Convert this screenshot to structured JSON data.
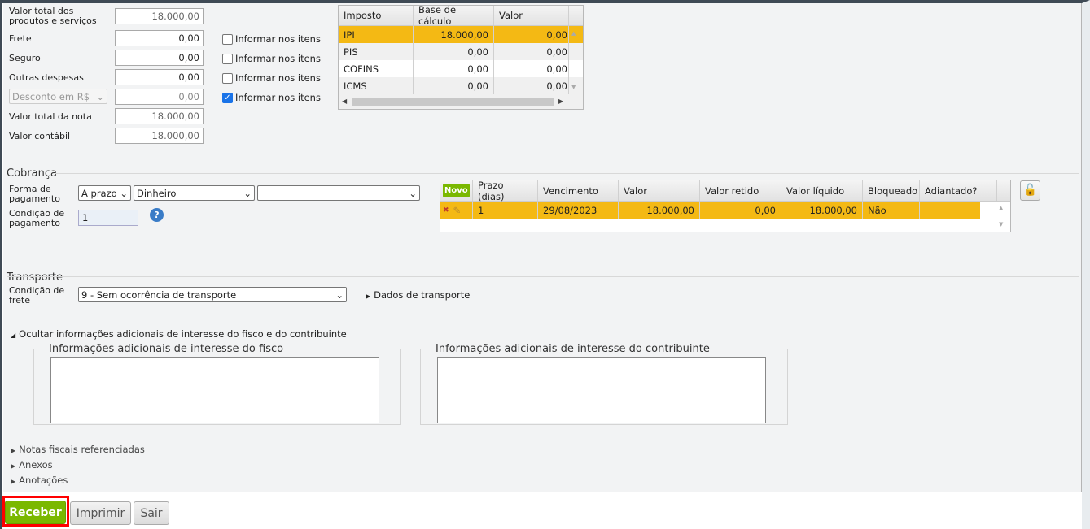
{
  "totals": {
    "rows": [
      {
        "label": "Valor total dos produtos e serviços",
        "value": "18.000,00",
        "readonly": true
      },
      {
        "label": "Frete",
        "value": "0,00",
        "check": "Informar nos itens",
        "checked": false
      },
      {
        "label": "Seguro",
        "value": "0,00",
        "check": "Informar nos itens",
        "checked": false
      },
      {
        "label": "Outras despesas",
        "value": "0,00",
        "check": "Informar nos itens",
        "checked": false
      },
      {
        "label": "Desconto em R$",
        "value": "0,00",
        "check": "Informar nos itens",
        "checked": true,
        "select": true
      },
      {
        "label": "Valor total da nota",
        "value": "18.000,00",
        "readonly": true
      },
      {
        "label": "Valor contábil",
        "value": "18.000,00",
        "readonly": true
      }
    ]
  },
  "taxes": {
    "headers": [
      "Imposto",
      "Base de cálculo",
      "Valor"
    ],
    "rows": [
      [
        "IPI",
        "18.000,00",
        "0,00"
      ],
      [
        "PIS",
        "0,00",
        "0,00"
      ],
      [
        "COFINS",
        "0,00",
        "0,00"
      ],
      [
        "ICMS",
        "0,00",
        "0,00"
      ]
    ]
  },
  "cobranca": {
    "title": "Cobrança",
    "forma_label": "Forma de pagamento",
    "forma_prazo": "A prazo",
    "forma_tipo": "Dinheiro",
    "forma_extra": "",
    "condicao_label": "Condição de pagamento",
    "condicao_value": "1",
    "help_icon": "?",
    "grid": {
      "novo": "Novo",
      "headers": [
        "Prazo (dias)",
        "Vencimento",
        "Valor",
        "Valor retido",
        "Valor líquido",
        "Bloqueado",
        "Adiantado?"
      ],
      "rows": [
        [
          "1",
          "29/08/2023",
          "18.000,00",
          "0,00",
          "18.000,00",
          "Não",
          ""
        ]
      ]
    }
  },
  "transporte": {
    "title": "Transporte",
    "cond_label": "Condição de frete",
    "cond_value": "9 - Sem ocorrência de transporte",
    "dados_link": "Dados de transporte"
  },
  "adicionais": {
    "toggle": "Ocultar informações adicionais de interesse do fisco e do contribuinte",
    "fisco": "Informações adicionais de interesse do fisco",
    "contribuinte": "Informações adicionais de interesse do contribuinte"
  },
  "links": [
    "Notas fiscais referenciadas",
    "Anexos",
    "Anotações"
  ],
  "buttons": {
    "receber": "Receber",
    "imprimir": "Imprimir",
    "sair": "Sair"
  },
  "colors": {
    "selected": "#f4b914",
    "accent": "#7ab800",
    "highlight": "#ff0000"
  }
}
